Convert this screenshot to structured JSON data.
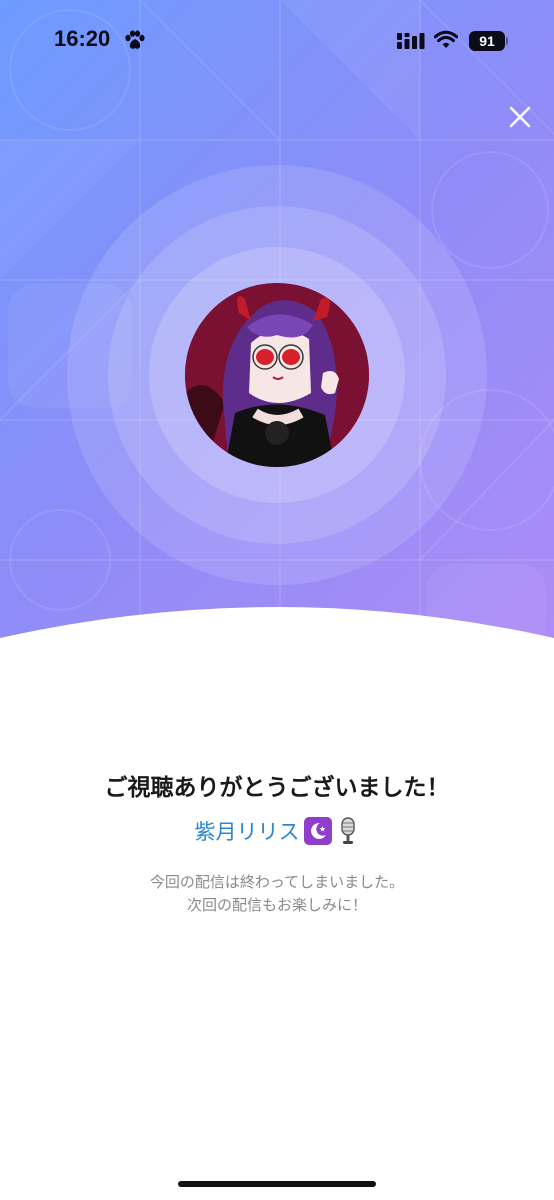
{
  "status_bar": {
    "time": "16:20",
    "battery": "91",
    "icons": [
      "paw-icon",
      "signal-icon",
      "wifi-icon",
      "battery-icon"
    ]
  },
  "header": {
    "close_icon": "close-icon"
  },
  "colors": {
    "gradient_start": "#6d9bff",
    "gradient_end": "#b08cf6",
    "streamer_name": "#2c86d6",
    "title_text": "#1a1a1a",
    "message_text": "#8a8a8a"
  },
  "end_screen": {
    "title": "ご視聴ありがとうございました！",
    "streamer_name": "紫月リリス",
    "name_emojis": [
      "moon-emoji",
      "microphone-emoji"
    ],
    "message_line1": "今回の配信は終わってしまいました。",
    "message_line2": "次回の配信もお楽しみに！"
  }
}
